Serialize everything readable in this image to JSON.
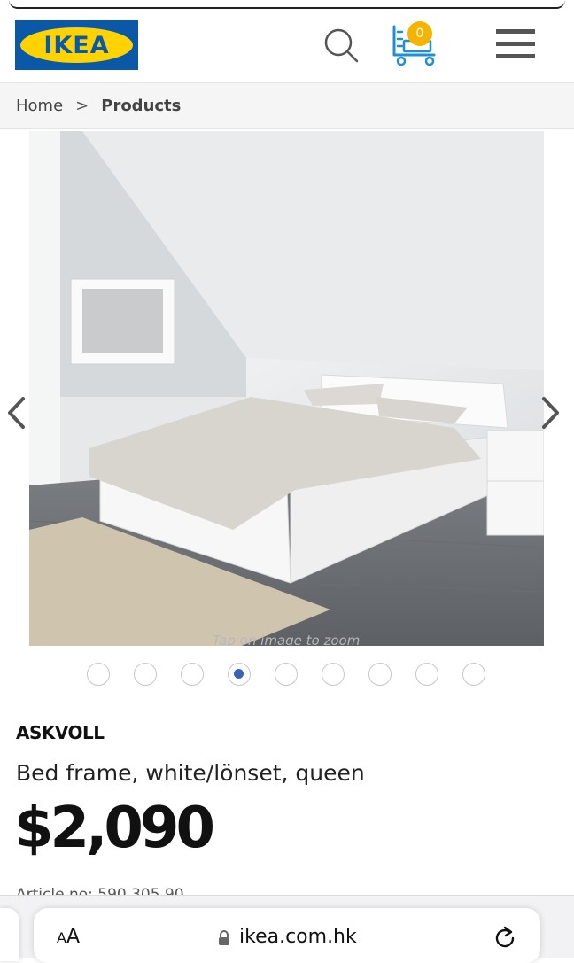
{
  "header": {
    "logo_text": "IKEA",
    "cart_count": "0",
    "icons": [
      "search-icon",
      "cart-icon",
      "menu-icon"
    ],
    "colors": {
      "logo_blue": "#0a58a8",
      "logo_yellow": "#ffd200",
      "badge": "#f5b400",
      "cart_blue": "#1f8fd6"
    }
  },
  "breadcrumb": {
    "home": "Home",
    "separator": ">",
    "current": "Products"
  },
  "gallery": {
    "image_hint": "Tap on image to zoom",
    "dot_count": 9,
    "active_index": 3,
    "active_color": "#3b63b5"
  },
  "product": {
    "name": "ASKVOLL",
    "description": "Bed frame, white/lönset, queen",
    "price": "$2,090",
    "article": "Article no: 590.305.90"
  },
  "browser": {
    "text_size_label_small": "A",
    "text_size_label_large": "A",
    "url": "ikea.com.hk",
    "icons": [
      "lock-icon",
      "reload-icon"
    ]
  }
}
